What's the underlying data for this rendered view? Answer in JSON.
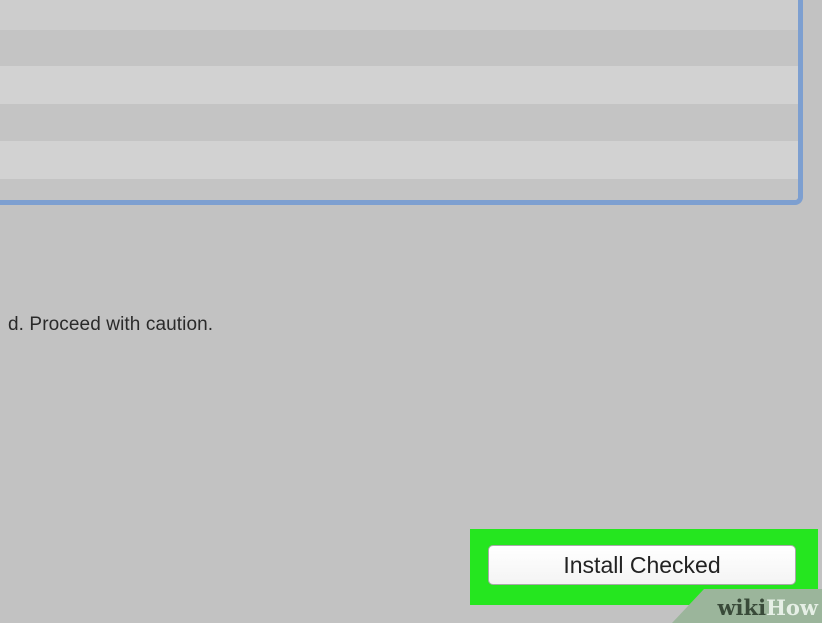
{
  "dialog": {
    "warning_text": "d. Proceed with caution.",
    "install_button_label": "Install Checked"
  },
  "watermark": {
    "part1": "wiki",
    "part2": "How"
  },
  "colors": {
    "background": "#c2c2c2",
    "list_border": "#7d9fd0",
    "highlight": "#25e61f"
  }
}
